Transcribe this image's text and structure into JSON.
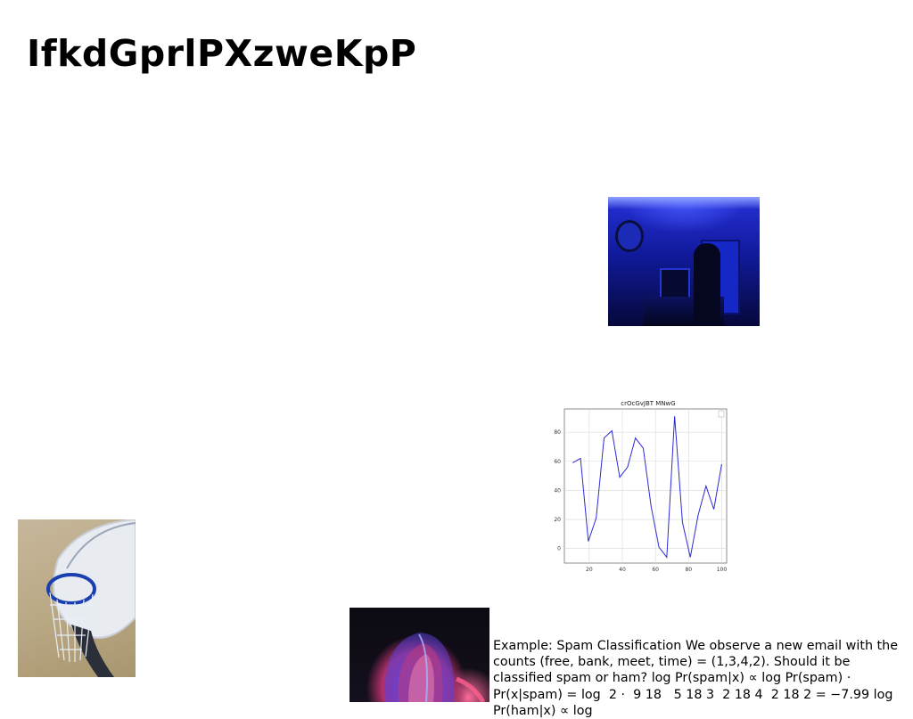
{
  "title": "IfkdGprlPXzweKpP",
  "images": {
    "blue_room": "blue-lit-room-photo",
    "basketball": "basketball-hoop-photo",
    "abstract": "abstract-swirl-photo"
  },
  "body_text": "Example: Spam Classification We observe a new email with the counts (free, bank, meet, time) = (1,3,4,2). Should it be classified spam or ham? log Pr(spam|x) ∝ log Pr(spam) · Pr(x|spam) = log ⁡ 2 · ⁡ 9 18 ⁡ ⁡ 5 18 ⁡3 ⁡ 2 18 ⁡4 ⁡ 2 18 ⁡2⁡ = −7.99 log Pr(ham|x) ∝ log",
  "chart_data": {
    "type": "line",
    "title": "crOcGvJBT MNwG",
    "x": [
      10,
      15,
      20,
      25,
      30,
      35,
      40,
      45,
      50,
      55,
      60,
      65,
      70,
      75,
      80,
      85,
      90,
      95,
      100
    ],
    "series": [
      {
        "values": [
          59,
          62,
          5,
          21,
          76,
          81,
          49,
          56,
          76,
          69,
          29,
          1,
          -6,
          91,
          18,
          -6,
          23,
          43,
          27,
          58
        ],
        "color": "#2b2bd6"
      }
    ],
    "xticks": [
      20,
      40,
      60,
      80,
      100
    ],
    "yticks": [
      0,
      20,
      40,
      60,
      80
    ],
    "xlim": [
      5,
      103
    ],
    "ylim": [
      -10,
      96
    ],
    "grid": true,
    "legend": "top-right"
  }
}
